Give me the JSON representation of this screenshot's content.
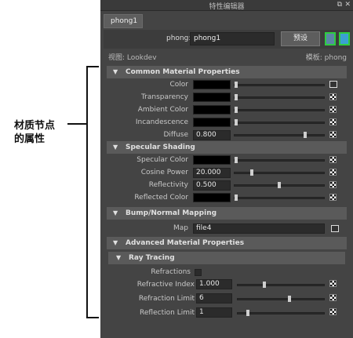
{
  "callout": {
    "text": "材质节点\n的属性"
  },
  "window": {
    "title": "特性编辑器",
    "float_icon": "⧉",
    "close_icon": "✕"
  },
  "tab": {
    "label": "phong1"
  },
  "node": {
    "label": "phong:",
    "value": "phong1",
    "preset_label": "预设"
  },
  "view_row": {
    "left": "视图: Lookdev",
    "right": "模板: phong"
  },
  "sections": {
    "common": "Common Material Properties",
    "specular": "Specular Shading",
    "bump": "Bump/Normal Mapping",
    "advanced": "Advanced Material Properties",
    "raytracing": "Ray Tracing"
  },
  "common_attrs": [
    {
      "label": "Color",
      "kind": "color"
    },
    {
      "label": "Transparency",
      "kind": "color"
    },
    {
      "label": "Ambient Color",
      "kind": "color"
    },
    {
      "label": "Incandescence",
      "kind": "color"
    },
    {
      "label": "Diffuse",
      "kind": "number",
      "value": "0.800",
      "fraction": 0.8
    }
  ],
  "specular_attrs": [
    {
      "label": "Specular Color",
      "kind": "color"
    },
    {
      "label": "Cosine Power",
      "kind": "number",
      "value": "20.000",
      "fraction": 0.18
    },
    {
      "label": "Reflectivity",
      "kind": "number",
      "value": "0.500",
      "fraction": 0.5
    },
    {
      "label": "Reflected Color",
      "kind": "color"
    }
  ],
  "bump": {
    "label": "Map",
    "value": "file4"
  },
  "ray_attrs": {
    "refractions": "Refractions",
    "refractive_index": {
      "label": "Refractive Index",
      "value": "1.000",
      "fraction": 0.3
    },
    "refraction_limit": {
      "label": "Refraction Limit",
      "value": "6",
      "fraction": 0.6
    },
    "reflection_limit": {
      "label": "Reflection Limit",
      "value": "1",
      "fraction": 0.1
    }
  }
}
